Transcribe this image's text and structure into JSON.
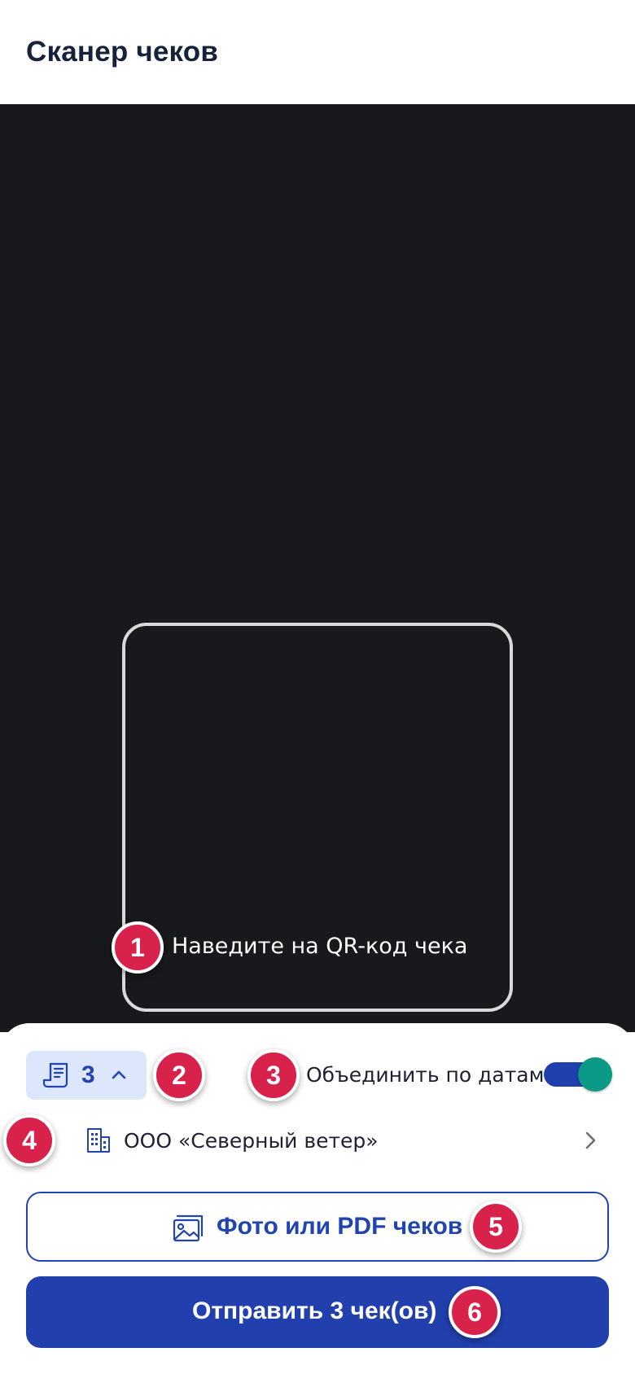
{
  "header": {
    "title": "Сканер чеков"
  },
  "scanner": {
    "hint": "Наведите на QR-код чека"
  },
  "controls": {
    "receipt_count": "3",
    "merge_label": "Объединить по датам",
    "merge_enabled": true
  },
  "company": {
    "name": "ООО «Северный ветер»"
  },
  "buttons": {
    "upload_label": "Фото или PDF чеков",
    "send_label": "Отправить 3 чек(ов)"
  },
  "annotations": [
    "1",
    "2",
    "3",
    "4",
    "5",
    "6"
  ],
  "colors": {
    "accent": "#2244b0",
    "badge": "#d8224b",
    "toggle_knob": "#0b9a86",
    "camera_bg": "#18191c"
  }
}
